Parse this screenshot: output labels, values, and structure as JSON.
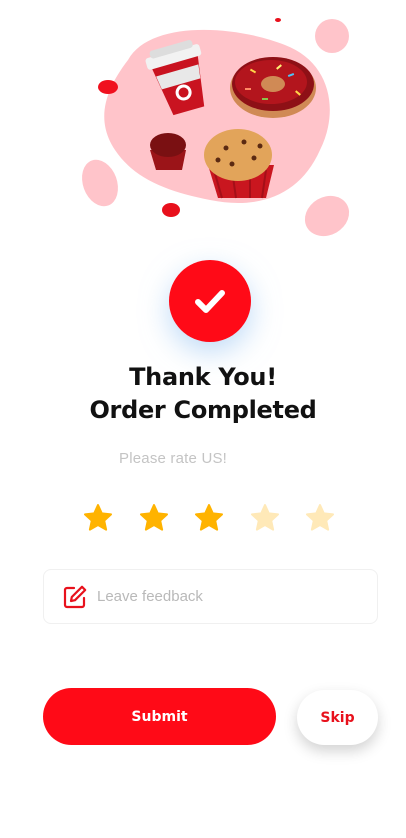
{
  "confirmation": {
    "title_line1": "Thank You!",
    "title_line2": "Order Completed"
  },
  "rating": {
    "prompt": "Please rate US!",
    "value": 3,
    "max": 5,
    "colors": {
      "filled": "#ffb300",
      "empty": "#ffe9b8"
    }
  },
  "feedback": {
    "placeholder": "Leave feedback",
    "value": ""
  },
  "actions": {
    "submit_label": "Submit",
    "skip_label": "Skip"
  },
  "theme": {
    "accent": "#ff0a17",
    "blob": "#ffc4ca"
  },
  "icons": {
    "status": "checkmark-icon",
    "feedback": "edit-icon",
    "illustration": [
      "coffee-cup",
      "donut",
      "muffin",
      "muffin"
    ]
  }
}
